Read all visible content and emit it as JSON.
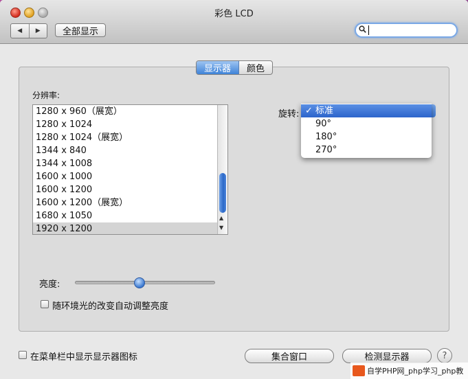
{
  "window": {
    "title": "彩色 LCD"
  },
  "toolbar": {
    "back_glyph": "◀",
    "forward_glyph": "▶",
    "show_all_label": "全部显示",
    "search": {
      "value": "",
      "placeholder": ""
    }
  },
  "tabs": [
    {
      "label": "显示器",
      "selected": true
    },
    {
      "label": "颜色",
      "selected": false
    }
  ],
  "resolution": {
    "label": "分辨率:",
    "items": [
      "1280 x 960（展宽）",
      "1280 x 1024",
      "1280 x 1024（展宽）",
      "1344 x 840",
      "1344 x 1008",
      "1600 x 1000",
      "1600 x 1200",
      "1600 x 1200（展宽）",
      "1680 x 1050",
      "1920 x 1200"
    ],
    "selected_index": 9
  },
  "rotation": {
    "label": "旋转:",
    "checkmark": "✓",
    "options": [
      "标准",
      "90°",
      "180°",
      "270°"
    ],
    "selected_index": 0
  },
  "brightness": {
    "label": "亮度:",
    "level_fraction": 0.45
  },
  "auto_brightness": {
    "label": "随环境光的改变自动调整亮度",
    "checked": false
  },
  "menubar_checkbox": {
    "label": "在菜单栏中显示显示器图标",
    "checked": false
  },
  "buttons": {
    "gather": "集合窗口",
    "detect": "检测显示器",
    "help": "?"
  },
  "watermark": {
    "text": "自学PHP网_php学习_php教"
  },
  "colors": {
    "accent": "#3f83d8",
    "selection": "#d4d4d4"
  }
}
